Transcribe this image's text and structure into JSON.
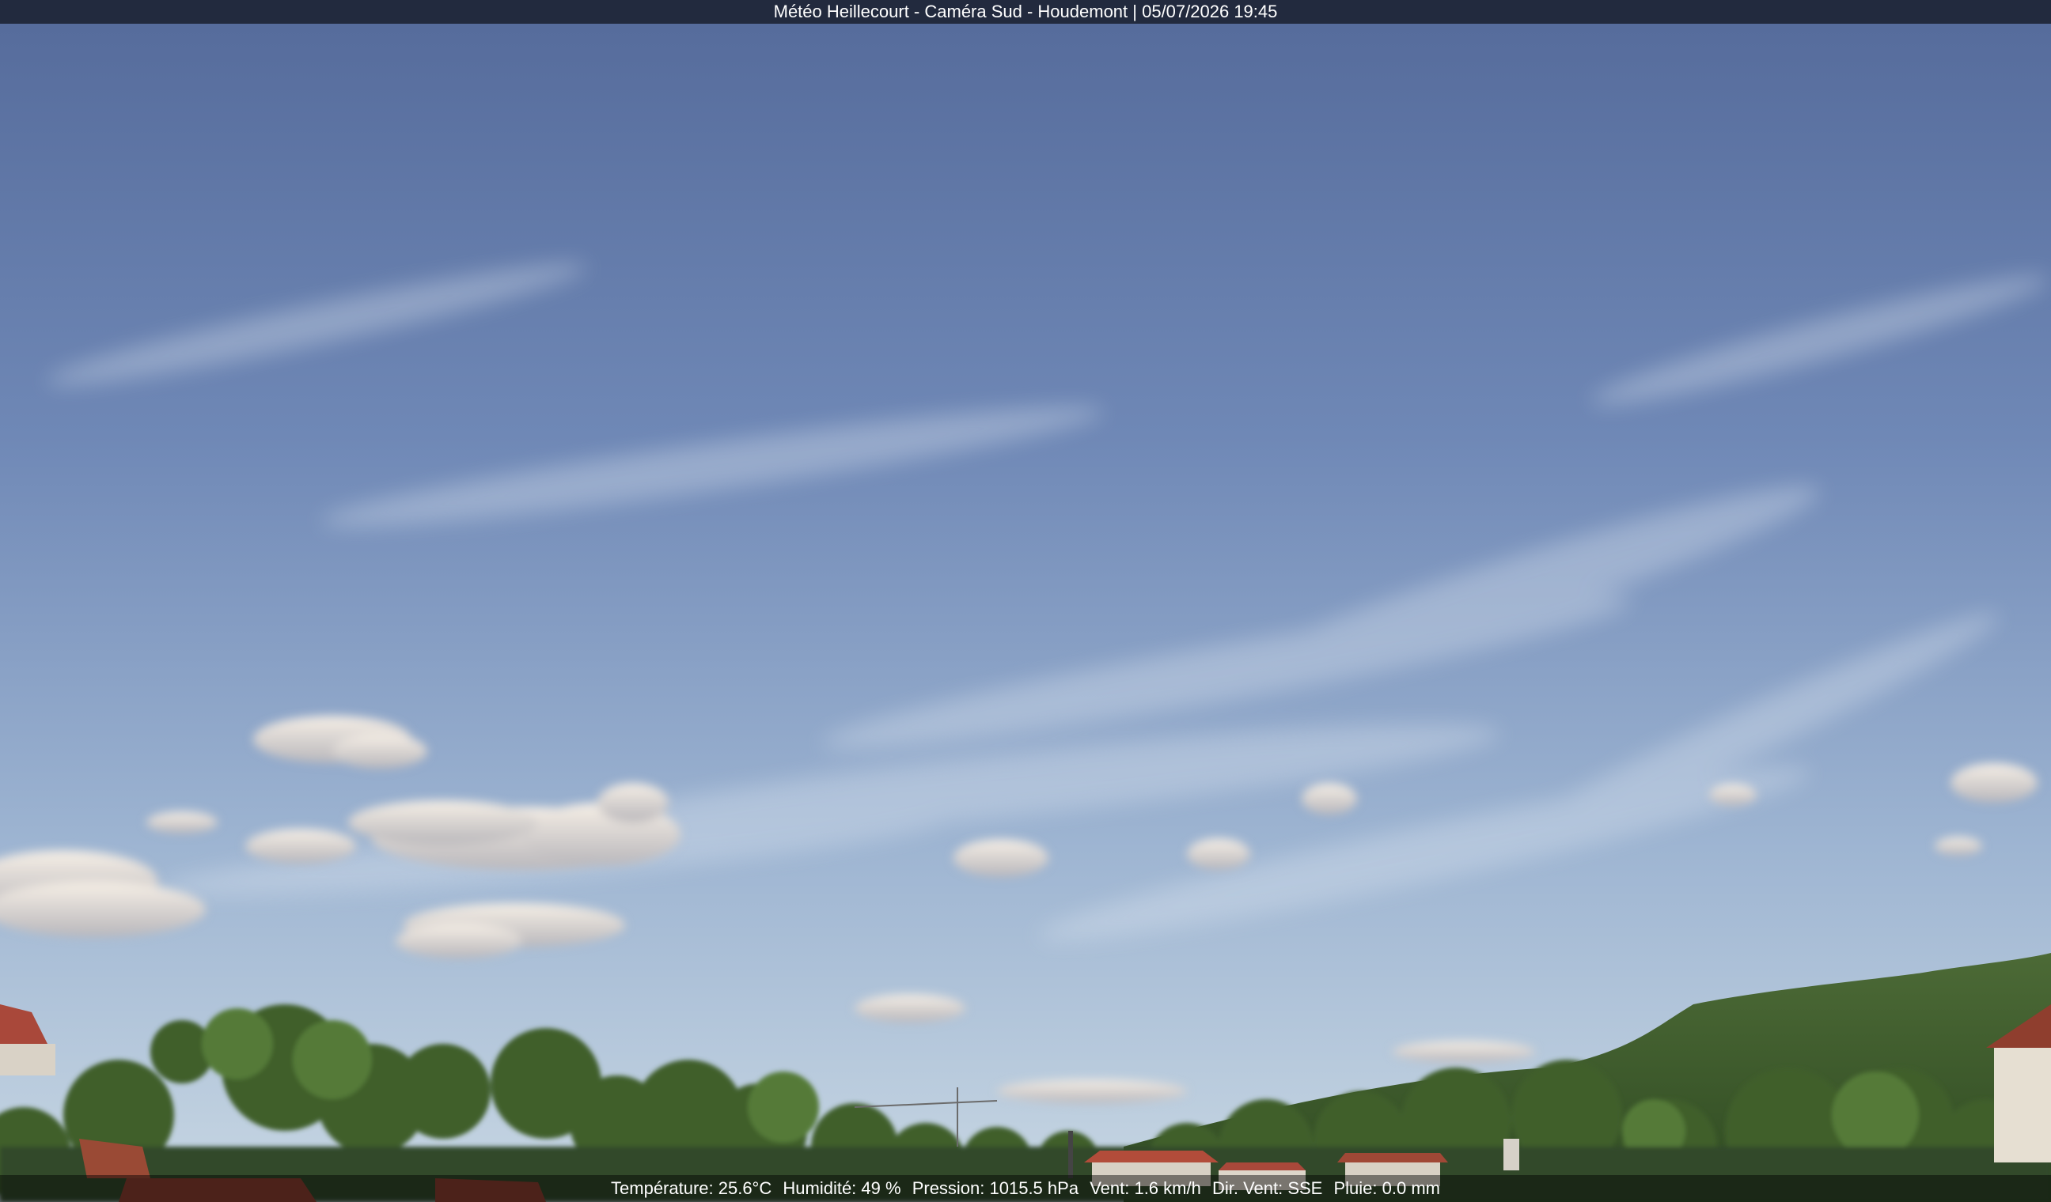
{
  "overlay": {
    "title": "Météo Heillecourt - Caméra Sud - Houdemont | 05/07/2026 19:45"
  },
  "weather": {
    "temperature": "Température: 25.6°C",
    "humidity": "Humidité: 49 %",
    "pressure": "Pression: 1015.5 hPa",
    "wind": "Vent: 1.6 km/h",
    "wind_dir": "Dir. Vent: SSE",
    "rain": "Pluie: 0.0 mm"
  },
  "colors": {
    "sky_top": "#5a72a2",
    "sky_bottom": "#c3d4e3",
    "vegetation": "#3d5a2a",
    "roof": "#9a4a35"
  }
}
